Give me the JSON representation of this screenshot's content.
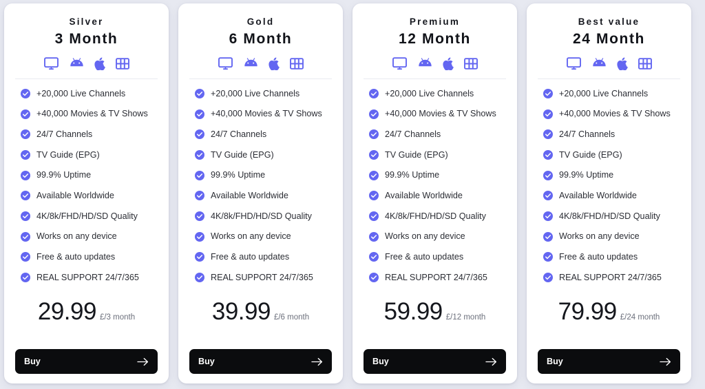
{
  "page": {
    "background_color": "#e7e9f1",
    "accent_color": "#6366f1",
    "button_color": "#0b0c0e"
  },
  "platform_icons": [
    {
      "name": "monitor-icon",
      "label": "Monitor / Smart TV"
    },
    {
      "name": "android-icon",
      "label": "Android"
    },
    {
      "name": "apple-icon",
      "label": "Apple"
    },
    {
      "name": "film-strip-icon",
      "label": "Media Player"
    }
  ],
  "features": [
    "+20,000 Live Channels",
    "+40,000 Movies & TV Shows",
    "24/7 Channels",
    "TV Guide (EPG)",
    "99.9% Uptime",
    "Available Worldwide",
    "4K/8k/FHD/HD/SD Quality",
    "Works on any device",
    "Free & auto updates",
    "REAL SUPPORT 24/7/365"
  ],
  "buy_label": "Buy",
  "plans": [
    {
      "tier": "Silver",
      "duration": "3 Month",
      "price": "29.99",
      "period": "£/3 month"
    },
    {
      "tier": "Gold",
      "duration": "6 Month",
      "price": "39.99",
      "period": "£/6 month"
    },
    {
      "tier": "Premium",
      "duration": "12 Month",
      "price": "59.99",
      "period": "£/12 month"
    },
    {
      "tier": "Best value",
      "duration": "24 Month",
      "price": "79.99",
      "period": "£/24 month"
    }
  ]
}
